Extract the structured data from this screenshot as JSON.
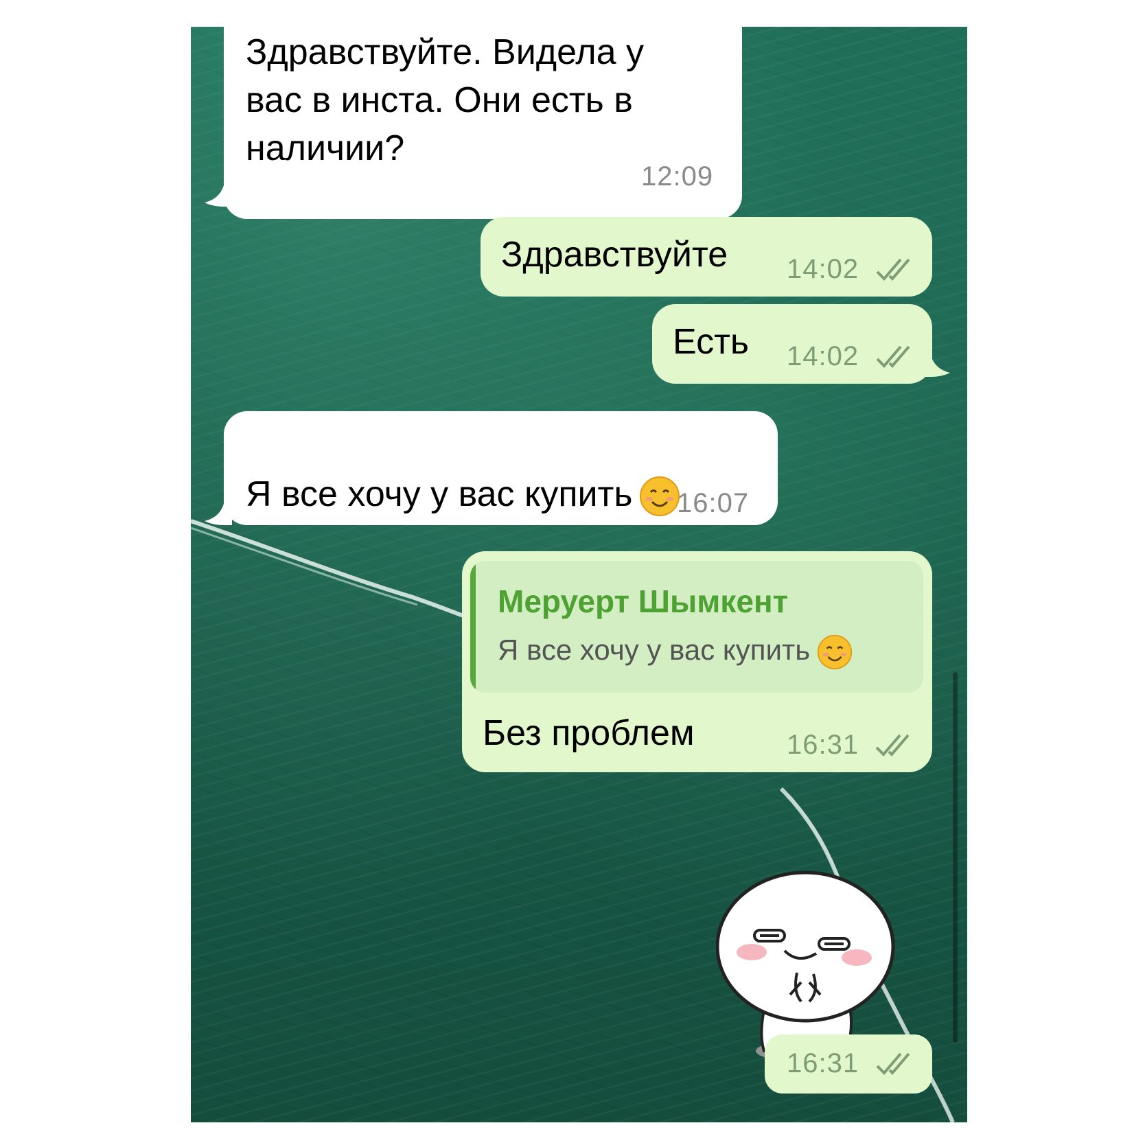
{
  "messages": [
    {
      "text": "Здравствуйте. Видела у\nвас в инста. Они есть в\nналичии?",
      "time": "12:09"
    },
    {
      "text": "Здравствуйте",
      "time": "14:02"
    },
    {
      "text": "Есть",
      "time": "14:02"
    },
    {
      "text": "Я все хочу у вас купить",
      "time": "16:07",
      "emoji": "smiling-face-emoji"
    },
    {
      "reply_name": "Меруерт Шымкент",
      "reply_text": "Я все хочу у вас купить",
      "text": "Без проблем",
      "time": "16:31"
    },
    {
      "time": "16:31",
      "sticker": "white-blob-sticker"
    }
  ],
  "colors": {
    "incoming": "#ffffff",
    "outgoing": "#e2f7cb",
    "accent": "#4ea233",
    "background": "#1a5e4b"
  }
}
